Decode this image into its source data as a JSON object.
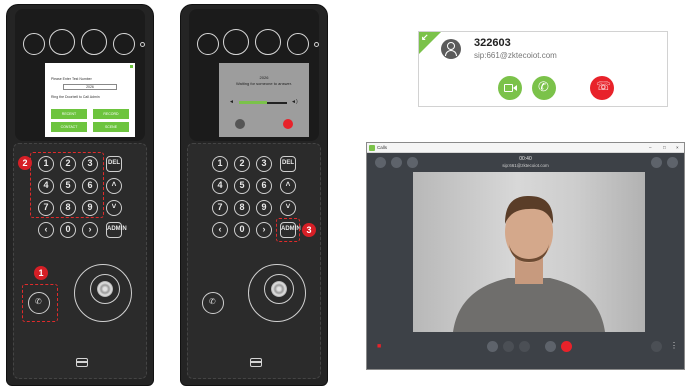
{
  "device1": {
    "screen": {
      "prompt": "Please Enter Test Number",
      "input_value": "2026",
      "hint": "Ring the Doorbell to Call Admin",
      "buttons": [
        "RECENT",
        "RECORD",
        "CONTACT",
        "SCENE"
      ]
    },
    "keys": [
      "1",
      "2",
      "3",
      "DEL",
      "4",
      "5",
      "6",
      "7",
      "8",
      "9",
      "0",
      "ADMIN"
    ],
    "markers": [
      "1",
      "2"
    ]
  },
  "device2": {
    "screen": {
      "number": "2026",
      "status": "Waiting for someone to answer."
    },
    "keys": [
      "1",
      "2",
      "3",
      "DEL",
      "4",
      "5",
      "6",
      "7",
      "8",
      "9",
      "0",
      "ADMIN"
    ],
    "markers": [
      "3"
    ]
  },
  "caller_card": {
    "number": "322603",
    "sip": "sip:661@zktecoiot.com",
    "colors": {
      "accept": "#7bc24a",
      "decline": "#e8222a"
    },
    "icons": [
      "incoming-call-icon",
      "user-icon",
      "video-call-icon",
      "phone-icon",
      "decline-call-icon"
    ]
  },
  "calls_window": {
    "title": "Calls",
    "window_controls": [
      "–",
      "□",
      "×"
    ],
    "timer": "00:40",
    "sip": "sip:661@zktecoiot.com",
    "icons": [
      "call-icon",
      "dialpad-icon",
      "signal-icon",
      "contacts-icon",
      "fullscreen-icon",
      "lock-icon",
      "mic-icon",
      "speaker-icon",
      "camera-off-icon",
      "pause-icon",
      "hangup-icon",
      "chat-icon",
      "more-icon"
    ]
  }
}
